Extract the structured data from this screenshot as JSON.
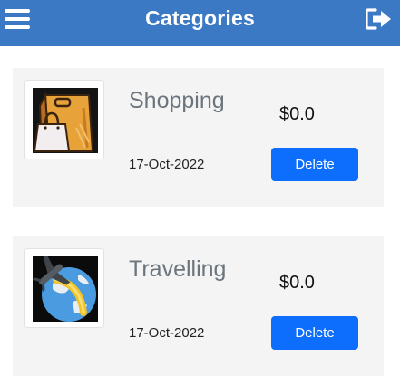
{
  "header": {
    "title": "Categories",
    "menu_icon": "hamburger-menu-icon",
    "logout_icon": "sign-out-icon",
    "background": "#3b79c4"
  },
  "categories": [
    {
      "name": "Shopping",
      "amount": "$0.0",
      "date": "17-Oct-2022",
      "delete_label": "Delete",
      "icon": "shopping-bags-icon"
    },
    {
      "name": "Travelling",
      "amount": "$0.0",
      "date": "17-Oct-2022",
      "delete_label": "Delete",
      "icon": "airplane-globe-icon"
    }
  ],
  "colors": {
    "accent": "#0d6efd",
    "card_background": "#f4f4f4",
    "category_text": "#6c757d"
  }
}
